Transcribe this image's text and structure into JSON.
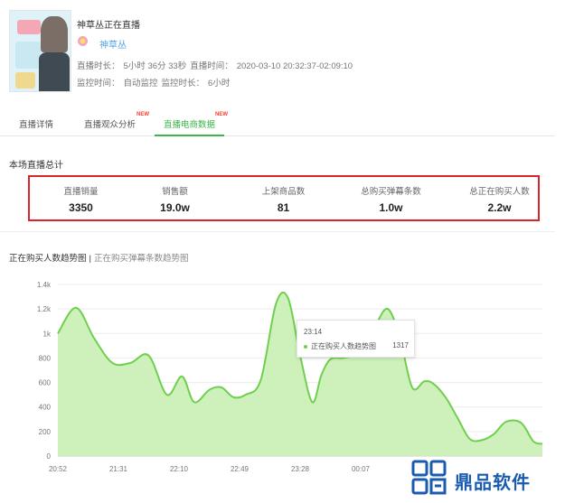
{
  "header": {
    "title": "神草丛正在直播",
    "anchor_name": "神草丛",
    "info_row1": [
      "直播时长：",
      "5小时 36分 33秒",
      "直播时间：",
      "2020-03-10 20:32:37-02:09:10"
    ],
    "info_row2": [
      "监控时间：",
      "自动监控",
      "监控时长：",
      "6小时"
    ]
  },
  "tabs": [
    {
      "label": "直播详情",
      "active": false,
      "badge": ""
    },
    {
      "label": "直播观众分析",
      "active": false,
      "badge": "NEW"
    },
    {
      "label": "直播电商数据",
      "active": true,
      "badge": "NEW"
    }
  ],
  "section_title": "本场直播总计",
  "summary": {
    "highlight_color": "#d9242b",
    "stats": [
      {
        "label": "直播销量",
        "value": "3350"
      },
      {
        "label": "销售额",
        "value": "19.0w"
      },
      {
        "label": "上架商品数",
        "value": "81"
      },
      {
        "label": "总购买弹幕条数",
        "value": "1.0w"
      },
      {
        "label": "总正在购买人数",
        "value": "2.2w"
      }
    ]
  },
  "chart_tabs": {
    "active": "正在购买人数趋势图",
    "separator": "|",
    "inactive": "正在购买弹幕条数趋势图"
  },
  "chart_data": {
    "type": "area",
    "series": [
      {
        "name": "正在购买人数趋势图",
        "color": "#6fcf4f",
        "fill": "#c9efb4",
        "x": [
          0,
          0.3,
          0.6,
          0.9,
          1.2,
          1.5,
          1.8,
          2.05,
          2.25,
          2.5,
          2.7,
          2.9,
          3.1,
          3.35,
          3.6,
          3.8,
          4.0,
          4.2,
          4.35,
          4.5,
          4.7,
          4.9,
          5.05,
          5.25,
          5.45,
          5.65,
          5.85,
          6.05,
          6.2,
          6.4,
          6.6,
          6.8,
          7.0,
          7.2,
          7.4,
          7.65,
          7.85,
          8.0
        ],
        "values": [
          1000,
          1210,
          960,
          760,
          760,
          820,
          500,
          650,
          440,
          540,
          560,
          480,
          500,
          620,
          1240,
          1290,
          820,
          440,
          660,
          790,
          800,
          820,
          860,
          1070,
          1200,
          960,
          560,
          610,
          590,
          480,
          310,
          140,
          130,
          180,
          280,
          270,
          120,
          100
        ]
      }
    ],
    "x_tick_labels": [
      "20:52",
      "21:31",
      "22:10",
      "22:49",
      "23:28",
      "00:07"
    ],
    "y_ticks": [
      "0",
      "200",
      "400",
      "600",
      "800",
      "1k",
      "1.2k",
      "1.4k"
    ],
    "ylim": [
      0,
      1400
    ],
    "grid": true
  },
  "tooltip": {
    "time": "23:14",
    "series": "正在购买人数趋势图",
    "value": "1317"
  },
  "watermark": {
    "text": "鼎品软件",
    "color": "#1a5bb0"
  }
}
